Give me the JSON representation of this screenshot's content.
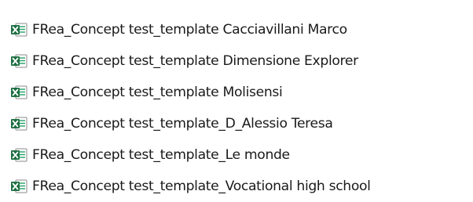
{
  "files": [
    {
      "name": "FRea_Concept test_template Cacciavillani Marco",
      "icon": "excel-icon"
    },
    {
      "name": "FRea_Concept test_template Dimensione Explorer",
      "icon": "excel-icon"
    },
    {
      "name": "FRea_Concept test_template Molisensi",
      "icon": "excel-icon"
    },
    {
      "name": "FRea_Concept test_template_D_Alessio Teresa",
      "icon": "excel-icon"
    },
    {
      "name": "FRea_Concept test_template_Le monde",
      "icon": "excel-icon"
    },
    {
      "name": "FRea_Concept test_template_Vocational high school",
      "icon": "excel-icon"
    }
  ],
  "colors": {
    "excel_green_dark": "#1d6f42",
    "excel_green": "#21a366",
    "text": "#1a1a1a"
  }
}
